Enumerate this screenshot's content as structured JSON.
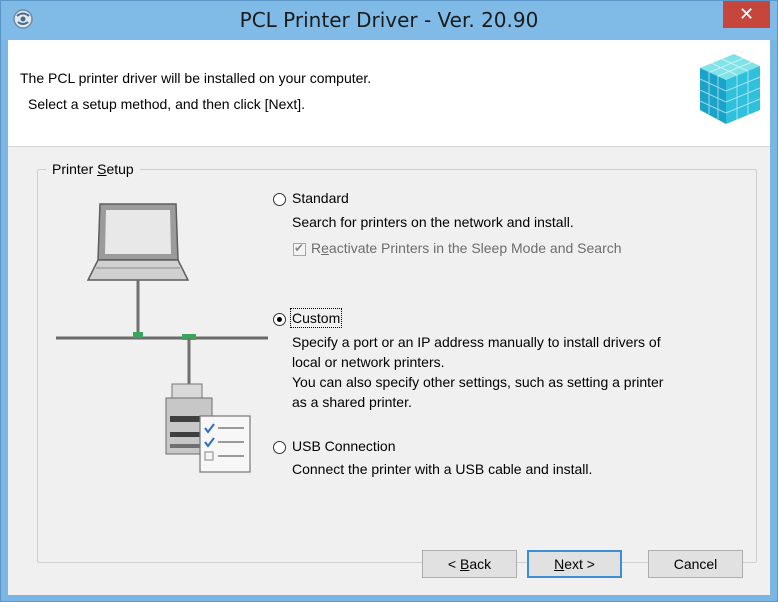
{
  "window": {
    "title": "PCL Printer Driver - Ver. 20.90",
    "close_glyph": "✕"
  },
  "header": {
    "line1": "The PCL printer driver will be installed on your computer.",
    "line2": "Select a setup method, and then click [Next].",
    "icon": "cube-installer-icon"
  },
  "group": {
    "label_pre": "Printer ",
    "label_ul": "S",
    "label_post": "etup"
  },
  "options": {
    "standard": {
      "label": "Standard",
      "selected": false,
      "desc": "Search for printers on the network and install.",
      "sub_check": {
        "pre": "R",
        "ul": "e",
        "post": "activate Printers in the Sleep Mode and Search",
        "checked": true,
        "enabled": false
      }
    },
    "custom": {
      "label": "Custom",
      "selected": true,
      "desc_lines": [
        "Specify a port or an IP address manually to install drivers of",
        "local or network printers.",
        "You can also specify other settings, such as setting a printer",
        "as a shared printer."
      ]
    },
    "usb": {
      "label": "USB Connection",
      "selected": false,
      "desc": "Connect the printer with a USB cable and install."
    }
  },
  "buttons": {
    "back": {
      "pre": "< ",
      "ul": "B",
      "post": "ack"
    },
    "next": {
      "pre": "",
      "ul": "N",
      "post": "ext >"
    },
    "cancel": "Cancel"
  },
  "colors": {
    "titlebar": "#7fbbe6",
    "close": "#c7463b",
    "accent": "#3c8fd6"
  }
}
